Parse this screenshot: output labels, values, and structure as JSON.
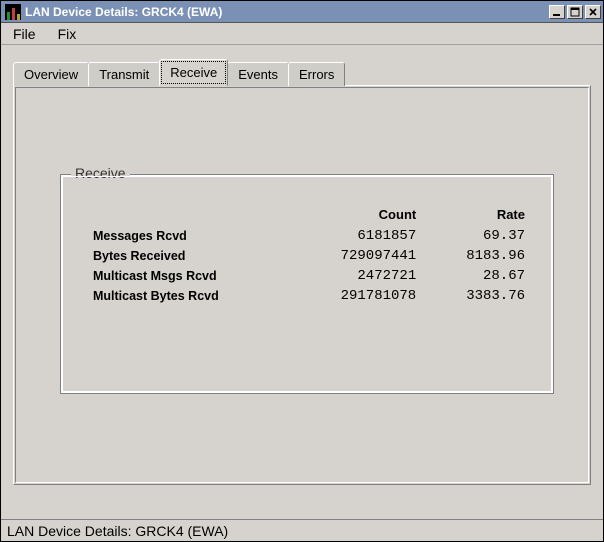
{
  "window": {
    "title": "LAN Device Details: GRCK4  (EWA)"
  },
  "menu": {
    "file": "File",
    "fix": "Fix"
  },
  "tabs": {
    "overview": "Overview",
    "transmit": "Transmit",
    "receive": "Receive",
    "events": "Events",
    "errors": "Errors"
  },
  "panel": {
    "legend": "Receive",
    "headers": {
      "label": "",
      "count": "Count",
      "rate": "Rate"
    },
    "rows": [
      {
        "label": "Messages Rcvd",
        "count": "6181857",
        "rate": "69.37"
      },
      {
        "label": "Bytes Received",
        "count": "729097441",
        "rate": "8183.96"
      },
      {
        "label": "Multicast Msgs Rcvd",
        "count": "2472721",
        "rate": "28.67"
      },
      {
        "label": "Multicast Bytes Rcvd",
        "count": "291781078",
        "rate": "3383.76"
      }
    ]
  },
  "status": {
    "text": "LAN Device Details: GRCK4  (EWA)"
  }
}
